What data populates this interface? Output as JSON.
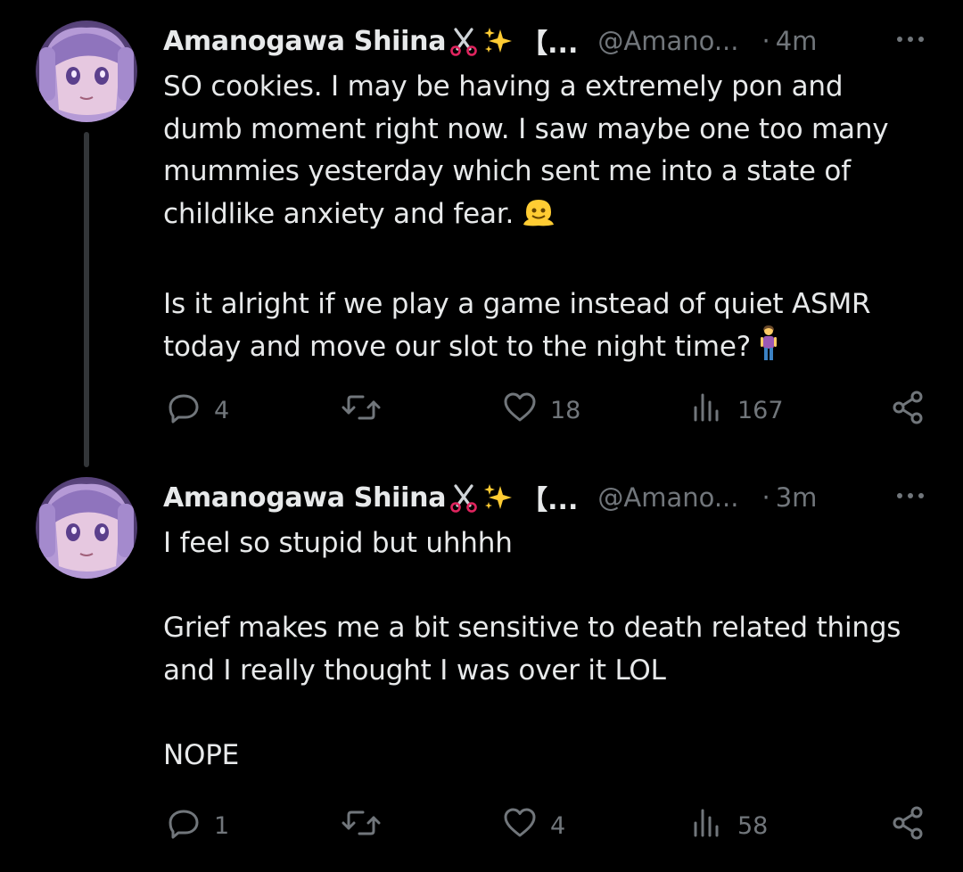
{
  "colors": {
    "background": "#000000",
    "text": "#e7e9ea",
    "secondary": "#71767b",
    "thread_line": "#333639"
  },
  "icons": {
    "scissors": "scissors-emoji",
    "sparkles": "sparkles-emoji",
    "smile_melting": "melting-face-emoji",
    "person": "person-standing-emoji",
    "more": "more-dots-icon",
    "reply": "reply-icon",
    "retweet": "retweet-icon",
    "like": "heart-icon",
    "views": "views-icon",
    "share": "share-icon"
  },
  "tweets": [
    {
      "display_name": "Amanogawa Shiina",
      "bracket": "【...",
      "handle": "@Amano...",
      "dot": "·",
      "time": "4m",
      "lines": [
        "SO cookies. I may be having a extremely pon and",
        "dumb moment right now. I saw maybe one too many",
        "mummies yesterday which sent me into a state of",
        "childlike anxiety and fear.",
        "Is it alright if we play a game instead of quiet ASMR",
        "today and move our slot to the night time?"
      ],
      "replies": "4",
      "retweets": "",
      "likes": "18",
      "views": "167"
    },
    {
      "display_name": "Amanogawa Shiina",
      "bracket": "【...",
      "handle": "@Amano...",
      "dot": "·",
      "time": "3m",
      "lines": [
        "I feel so stupid but uhhhh",
        "Grief makes me a bit sensitive to death related things",
        "and I really thought I was over it LOL",
        "NOPE"
      ],
      "replies": "1",
      "retweets": "",
      "likes": "4",
      "views": "58"
    }
  ]
}
